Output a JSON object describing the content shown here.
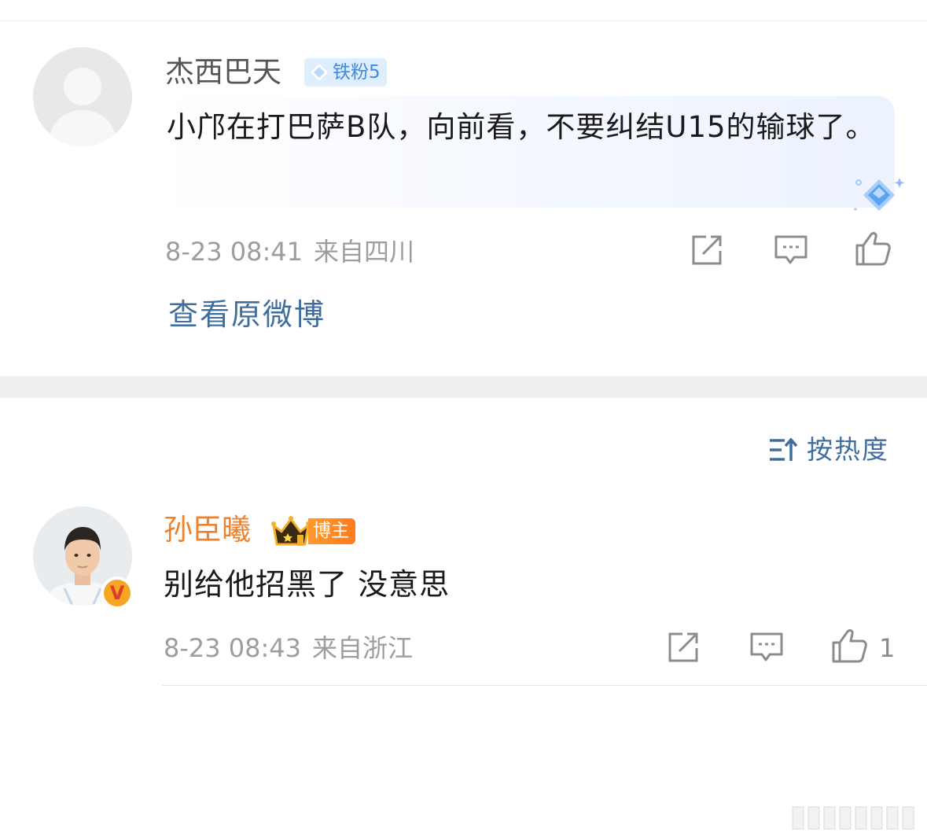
{
  "comment1": {
    "username": "杰西巴天",
    "fan_badge": "铁粉5",
    "text": "小邝在打巴萨B队，向前看，不要纠结U15的输球了。",
    "time": "8-23 08:41",
    "location": "来自四川",
    "actions": [
      "share-icon",
      "comment-icon",
      "like-icon"
    ]
  },
  "view_original_label": "查看原微博",
  "sort": {
    "label": "按热度",
    "icon": "sort-icon"
  },
  "comment2": {
    "username": "孙臣曦",
    "badge_label": "博主",
    "badge_icon": "crown-icon",
    "verified_mark": "V",
    "text": "别给他招黑了 没意思",
    "time": "8-23 08:43",
    "location": "来自浙江",
    "like_count": "1",
    "actions": [
      "share-icon",
      "comment-icon",
      "like-icon"
    ]
  },
  "colors": {
    "link_blue": "#3f6e9e",
    "blogger_orange": "#f0812a",
    "meta_gray": "#9d9d9d",
    "badge_blue": "#3d8be0"
  }
}
